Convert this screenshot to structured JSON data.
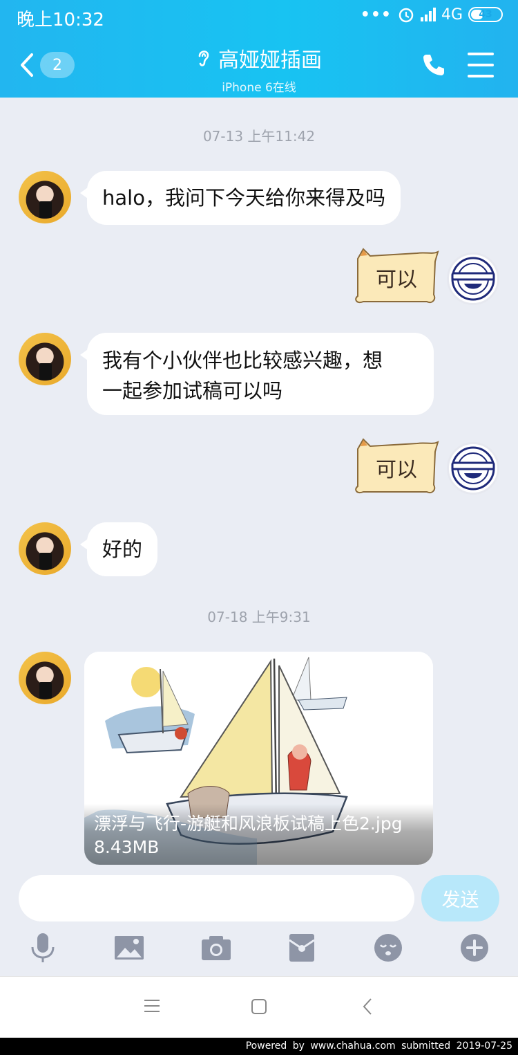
{
  "status_bar": {
    "time": "晚上10:32",
    "dots": "•••",
    "network": "4G",
    "battery": "43"
  },
  "header": {
    "back_count": "2",
    "title": "高娅娅插画",
    "subtitle": "iPhone 6在线"
  },
  "messages": [
    {
      "type": "timestamp",
      "text": "07-13 上午11:42"
    },
    {
      "type": "text",
      "from": "contact",
      "text": "halo，我问下今天给你来得及吗"
    },
    {
      "type": "sticker",
      "from": "me",
      "text": "可以"
    },
    {
      "type": "text",
      "from": "contact",
      "line1": "我有个小伙伴也比较感兴趣，想",
      "line2": "一起参加试稿可以吗"
    },
    {
      "type": "sticker",
      "from": "me",
      "text": "可以"
    },
    {
      "type": "text",
      "from": "contact",
      "text": "好的"
    },
    {
      "type": "timestamp",
      "text": "07-18 上午9:31"
    },
    {
      "type": "image",
      "from": "contact",
      "filename": "漂浮与飞行-游艇和风浪板试稿上色2.jpg",
      "size": "8.43MB"
    }
  ],
  "composer": {
    "placeholder": "",
    "send_label": "发送"
  },
  "tools": [
    "microphone-icon",
    "image-icon",
    "camera-icon",
    "red-packet-icon",
    "emoji-icon",
    "plus-icon"
  ],
  "footer": "Powered by www.chahua.com submitted 2019-07-25",
  "colors": {
    "header": "#1cbaf1",
    "chat_bg": "#eaedf4",
    "send_disabled": "#b8e8fa",
    "tool_icon": "#8e95a6"
  }
}
